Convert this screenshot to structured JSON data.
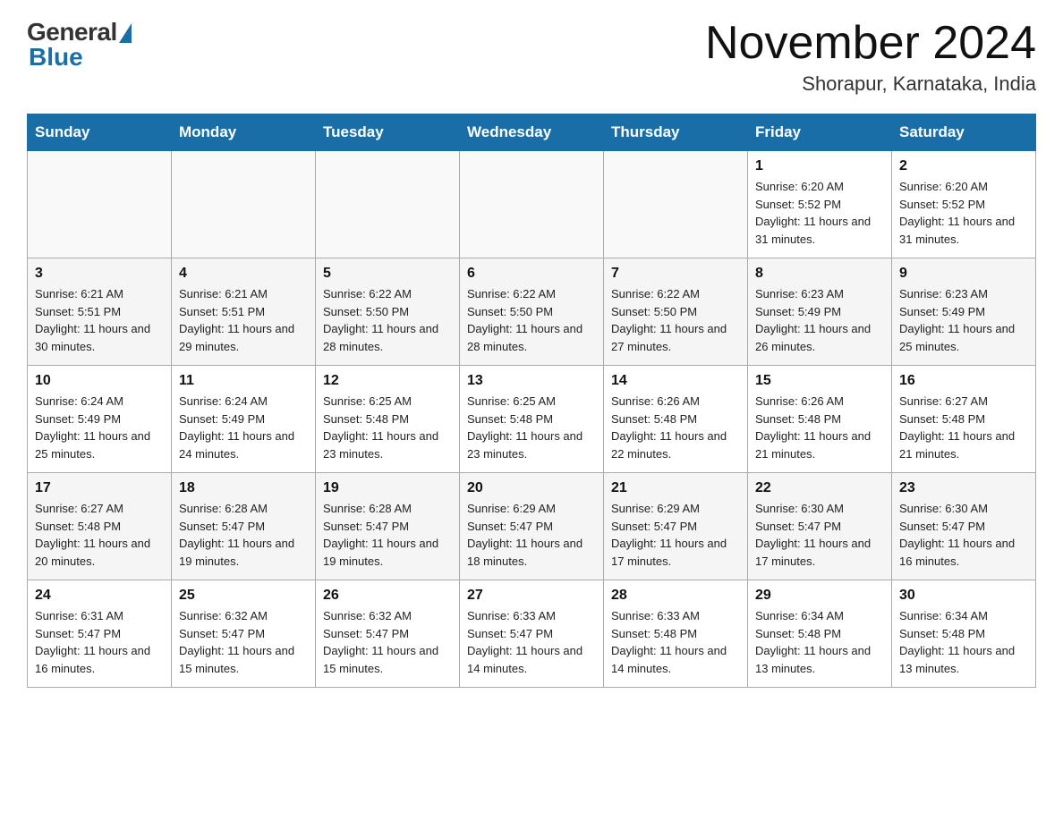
{
  "header": {
    "logo_general": "General",
    "logo_blue": "Blue",
    "month_title": "November 2024",
    "location": "Shorapur, Karnataka, India"
  },
  "weekdays": [
    "Sunday",
    "Monday",
    "Tuesday",
    "Wednesday",
    "Thursday",
    "Friday",
    "Saturday"
  ],
  "weeks": [
    [
      {
        "day": "",
        "info": ""
      },
      {
        "day": "",
        "info": ""
      },
      {
        "day": "",
        "info": ""
      },
      {
        "day": "",
        "info": ""
      },
      {
        "day": "",
        "info": ""
      },
      {
        "day": "1",
        "info": "Sunrise: 6:20 AM\nSunset: 5:52 PM\nDaylight: 11 hours and 31 minutes."
      },
      {
        "day": "2",
        "info": "Sunrise: 6:20 AM\nSunset: 5:52 PM\nDaylight: 11 hours and 31 minutes."
      }
    ],
    [
      {
        "day": "3",
        "info": "Sunrise: 6:21 AM\nSunset: 5:51 PM\nDaylight: 11 hours and 30 minutes."
      },
      {
        "day": "4",
        "info": "Sunrise: 6:21 AM\nSunset: 5:51 PM\nDaylight: 11 hours and 29 minutes."
      },
      {
        "day": "5",
        "info": "Sunrise: 6:22 AM\nSunset: 5:50 PM\nDaylight: 11 hours and 28 minutes."
      },
      {
        "day": "6",
        "info": "Sunrise: 6:22 AM\nSunset: 5:50 PM\nDaylight: 11 hours and 28 minutes."
      },
      {
        "day": "7",
        "info": "Sunrise: 6:22 AM\nSunset: 5:50 PM\nDaylight: 11 hours and 27 minutes."
      },
      {
        "day": "8",
        "info": "Sunrise: 6:23 AM\nSunset: 5:49 PM\nDaylight: 11 hours and 26 minutes."
      },
      {
        "day": "9",
        "info": "Sunrise: 6:23 AM\nSunset: 5:49 PM\nDaylight: 11 hours and 25 minutes."
      }
    ],
    [
      {
        "day": "10",
        "info": "Sunrise: 6:24 AM\nSunset: 5:49 PM\nDaylight: 11 hours and 25 minutes."
      },
      {
        "day": "11",
        "info": "Sunrise: 6:24 AM\nSunset: 5:49 PM\nDaylight: 11 hours and 24 minutes."
      },
      {
        "day": "12",
        "info": "Sunrise: 6:25 AM\nSunset: 5:48 PM\nDaylight: 11 hours and 23 minutes."
      },
      {
        "day": "13",
        "info": "Sunrise: 6:25 AM\nSunset: 5:48 PM\nDaylight: 11 hours and 23 minutes."
      },
      {
        "day": "14",
        "info": "Sunrise: 6:26 AM\nSunset: 5:48 PM\nDaylight: 11 hours and 22 minutes."
      },
      {
        "day": "15",
        "info": "Sunrise: 6:26 AM\nSunset: 5:48 PM\nDaylight: 11 hours and 21 minutes."
      },
      {
        "day": "16",
        "info": "Sunrise: 6:27 AM\nSunset: 5:48 PM\nDaylight: 11 hours and 21 minutes."
      }
    ],
    [
      {
        "day": "17",
        "info": "Sunrise: 6:27 AM\nSunset: 5:48 PM\nDaylight: 11 hours and 20 minutes."
      },
      {
        "day": "18",
        "info": "Sunrise: 6:28 AM\nSunset: 5:47 PM\nDaylight: 11 hours and 19 minutes."
      },
      {
        "day": "19",
        "info": "Sunrise: 6:28 AM\nSunset: 5:47 PM\nDaylight: 11 hours and 19 minutes."
      },
      {
        "day": "20",
        "info": "Sunrise: 6:29 AM\nSunset: 5:47 PM\nDaylight: 11 hours and 18 minutes."
      },
      {
        "day": "21",
        "info": "Sunrise: 6:29 AM\nSunset: 5:47 PM\nDaylight: 11 hours and 17 minutes."
      },
      {
        "day": "22",
        "info": "Sunrise: 6:30 AM\nSunset: 5:47 PM\nDaylight: 11 hours and 17 minutes."
      },
      {
        "day": "23",
        "info": "Sunrise: 6:30 AM\nSunset: 5:47 PM\nDaylight: 11 hours and 16 minutes."
      }
    ],
    [
      {
        "day": "24",
        "info": "Sunrise: 6:31 AM\nSunset: 5:47 PM\nDaylight: 11 hours and 16 minutes."
      },
      {
        "day": "25",
        "info": "Sunrise: 6:32 AM\nSunset: 5:47 PM\nDaylight: 11 hours and 15 minutes."
      },
      {
        "day": "26",
        "info": "Sunrise: 6:32 AM\nSunset: 5:47 PM\nDaylight: 11 hours and 15 minutes."
      },
      {
        "day": "27",
        "info": "Sunrise: 6:33 AM\nSunset: 5:47 PM\nDaylight: 11 hours and 14 minutes."
      },
      {
        "day": "28",
        "info": "Sunrise: 6:33 AM\nSunset: 5:48 PM\nDaylight: 11 hours and 14 minutes."
      },
      {
        "day": "29",
        "info": "Sunrise: 6:34 AM\nSunset: 5:48 PM\nDaylight: 11 hours and 13 minutes."
      },
      {
        "day": "30",
        "info": "Sunrise: 6:34 AM\nSunset: 5:48 PM\nDaylight: 11 hours and 13 minutes."
      }
    ]
  ]
}
